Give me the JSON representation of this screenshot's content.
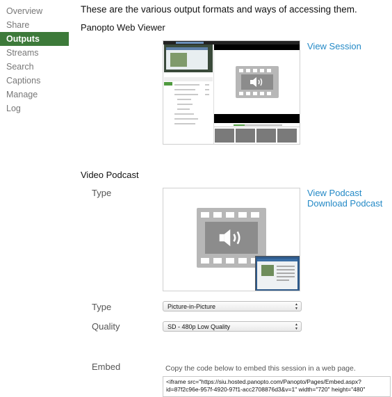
{
  "sidebar": {
    "items": [
      {
        "label": "Overview"
      },
      {
        "label": "Share"
      },
      {
        "label": "Outputs",
        "active": true
      },
      {
        "label": "Streams"
      },
      {
        "label": "Search"
      },
      {
        "label": "Captions"
      },
      {
        "label": "Manage"
      },
      {
        "label": "Log"
      }
    ]
  },
  "intro": "These are the various output formats and ways of accessing them.",
  "web_viewer": {
    "title": "Panopto Web Viewer",
    "view_link": "View Session"
  },
  "podcast": {
    "title": "Video Podcast",
    "type_label": "Type",
    "view_link": "View Podcast",
    "download_link": "Download Podcast",
    "type_select_label": "Type",
    "type_value": "Picture-in-Picture",
    "quality_label": "Quality",
    "quality_value": "SD - 480p Low Quality"
  },
  "embed": {
    "label": "Embed",
    "help": "Copy the code below to embed this session in a web page.",
    "code": "<iframe src=\"https://siu.hosted.panopto.com/Panopto/Pages/Embed.aspx?id=87f2c96e-957f-4920-97f1-acc2708876d3&v=1\" width=\"720\" height=\"480\""
  },
  "colors": {
    "accent_green": "#3d7a3a",
    "link_blue": "#2389c6"
  }
}
